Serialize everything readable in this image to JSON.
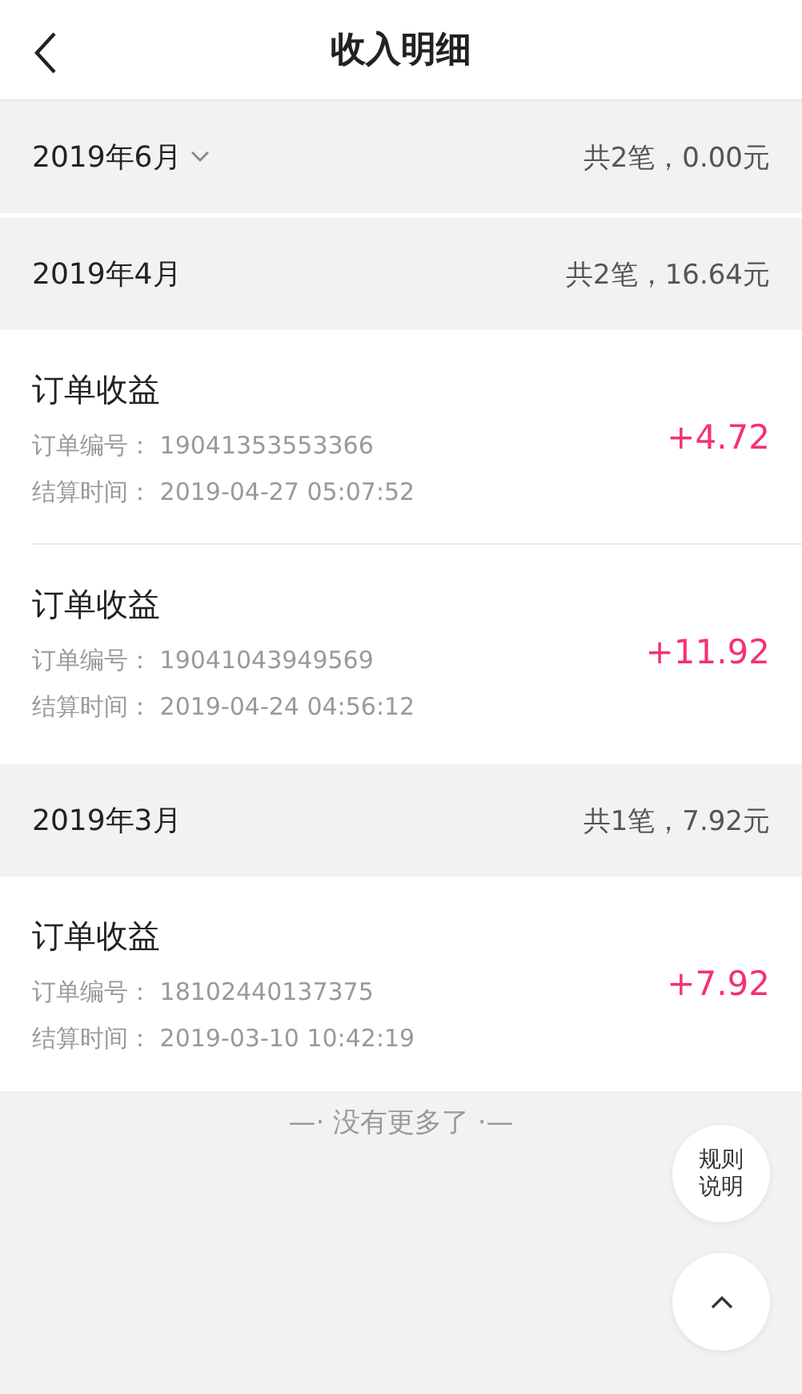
{
  "header": {
    "title": "收入明细"
  },
  "months": [
    {
      "label": "2019年6月",
      "has_picker": true,
      "summary": "共2笔，0.00元"
    },
    {
      "label": "2019年4月",
      "has_picker": false,
      "summary": "共2笔，16.64元",
      "entries": [
        {
          "title": "订单收益",
          "order_label": "订单编号：",
          "order_no": "19041353553366",
          "time_label": "结算时间：",
          "time": "2019-04-27 05:07:52",
          "amount": "+4.72"
        },
        {
          "title": "订单收益",
          "order_label": "订单编号：",
          "order_no": "19041043949569",
          "time_label": "结算时间：",
          "time": "2019-04-24 04:56:12",
          "amount": "+11.92"
        }
      ]
    },
    {
      "label": "2019年3月",
      "has_picker": false,
      "summary": "共1笔，7.92元",
      "entries": [
        {
          "title": "订单收益",
          "order_label": "订单编号：",
          "order_no": "18102440137375",
          "time_label": "结算时间：",
          "time": "2019-03-10 10:42:19",
          "amount": "+7.92"
        }
      ]
    }
  ],
  "end_note": "—· 没有更多了 ·—",
  "rules_button": {
    "line_1": "规则",
    "line_2": "说明"
  }
}
